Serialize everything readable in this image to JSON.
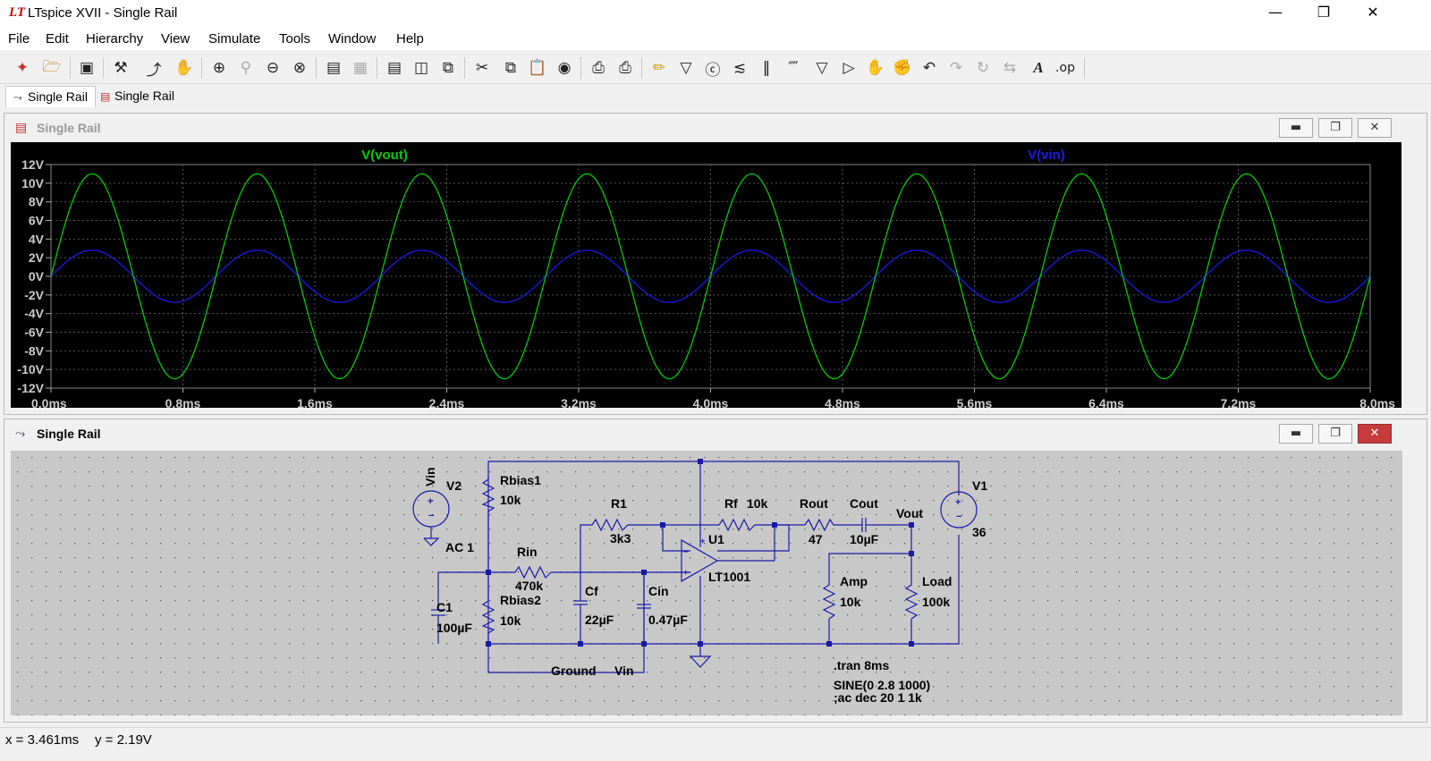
{
  "app": {
    "title": "LTspice XVII - Single Rail",
    "logo": "LT",
    "window_buttons": [
      "minimize-icon",
      "restore-icon",
      "close-icon"
    ]
  },
  "menu": [
    "File",
    "Edit",
    "Hierarchy",
    "View",
    "Simulate",
    "Tools",
    "Window",
    "Help"
  ],
  "toolbar": {
    "icons": [
      "new-schematic-icon",
      "open-icon",
      "save-icon",
      "control-panel-icon",
      "run-icon",
      "halt-icon",
      "zoom-in-icon",
      "zoom-pan-icon",
      "zoom-out-icon",
      "zoom-cancel-icon",
      "autorange-icon",
      "waveform-icon",
      "tile-horizontal-icon",
      "tile-vertical-icon",
      "cascade-icon",
      "cut-icon",
      "copy-icon",
      "paste-icon",
      "find-icon",
      "print-setup-icon",
      "print-icon",
      "draw-wire-icon",
      "ground-icon",
      "label-net-icon",
      "resistor-icon",
      "capacitor-icon",
      "inductor-icon",
      "diode-icon",
      "component-icon",
      "move-icon",
      "drag-icon",
      "undo-icon",
      "redo-icon",
      "rotate-icon",
      "mirror-icon",
      "text-icon",
      "spice-directive-icon"
    ],
    "op_label": ".op"
  },
  "tabs": [
    {
      "label": "Single Rail",
      "icon": "schematic-icon",
      "active": true
    },
    {
      "label": "Single Rail",
      "icon": "waveform-icon",
      "active": false
    }
  ],
  "waveform_window": {
    "title": "Single Rail",
    "traces": [
      {
        "name": "V(vout)",
        "color": "#00cc00"
      },
      {
        "name": "V(vin)",
        "color": "#1a1ae6"
      }
    ],
    "y_ticks": [
      "12V",
      "10V",
      "8V",
      "6V",
      "4V",
      "2V",
      "0V",
      "-2V",
      "-4V",
      "-6V",
      "-8V",
      "-10V",
      "-12V"
    ],
    "x_ticks": [
      "0.0ms",
      "0.8ms",
      "1.6ms",
      "2.4ms",
      "3.2ms",
      "4.0ms",
      "4.8ms",
      "5.6ms",
      "6.4ms",
      "7.2ms",
      "8.0ms"
    ]
  },
  "chart_data": {
    "type": "line",
    "title": "",
    "xlabel": "",
    "ylabel": "",
    "xlim": [
      0,
      8
    ],
    "x_unit": "ms",
    "ylim": [
      -12,
      12
    ],
    "y_unit": "V",
    "grid": true,
    "legend": "top",
    "series": [
      {
        "name": "V(vout)",
        "color": "#00cc00",
        "waveform": "sine",
        "amplitude": 11.0,
        "frequency_hz": 1000,
        "phase": "starts at 0V rising"
      },
      {
        "name": "V(vin)",
        "color": "#1a1ae6",
        "waveform": "sine",
        "amplitude": 2.8,
        "frequency_hz": 1000,
        "phase": "starts at 0V rising"
      }
    ]
  },
  "schematic_window": {
    "title": "Single Rail",
    "components": {
      "v2": {
        "name": "V2",
        "net": "Vin",
        "value": "AC 1"
      },
      "rbias1": {
        "name": "Rbias1",
        "value": "10k"
      },
      "rbias2": {
        "name": "Rbias2",
        "value": "10k"
      },
      "rin": {
        "name": "Rin",
        "value": "470k"
      },
      "c1": {
        "name": "C1",
        "value": "100µF"
      },
      "r1": {
        "name": "R1",
        "value": "3k3"
      },
      "cf": {
        "name": "Cf",
        "value": "22µF"
      },
      "cin": {
        "name": "Cin",
        "value": "0.47µF"
      },
      "rf": {
        "name": "Rf",
        "value": "10k"
      },
      "u1": {
        "name": "U1",
        "value": "LT1001"
      },
      "rout": {
        "name": "Rout",
        "value": "47"
      },
      "cout": {
        "name": "Cout",
        "value": "10µF"
      },
      "amp": {
        "name": "Amp",
        "value": "10k"
      },
      "load": {
        "name": "Load",
        "value": "100k"
      },
      "v1": {
        "name": "V1",
        "value": "36"
      }
    },
    "labels": {
      "vout": "Vout",
      "ground": "Ground",
      "vin_bottom": "Vin"
    },
    "directives": {
      "tran": ".tran 8ms",
      "sine": "SINE(0 2.8 1000)",
      "ac": ";ac dec 20 1 1k"
    }
  },
  "status": {
    "x": "x = 3.461ms",
    "y": "y = 2.19V"
  }
}
